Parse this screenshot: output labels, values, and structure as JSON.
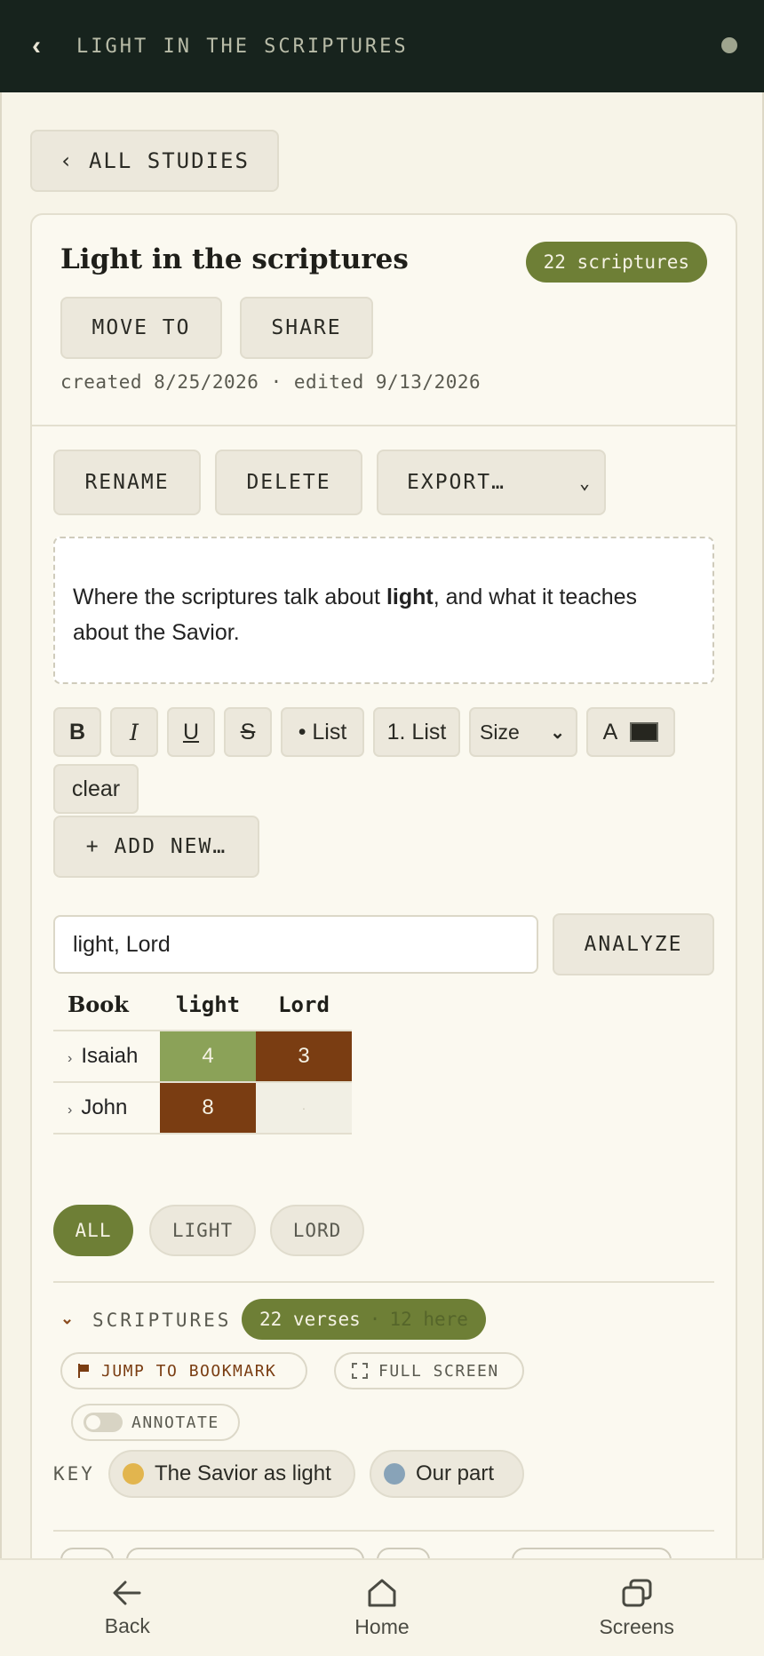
{
  "topbar": {
    "back_glyph": "‹",
    "title": "LIGHT IN THE SCRIPTURES"
  },
  "nav": {
    "all_studies": "‹ ALL STUDIES"
  },
  "study": {
    "title": "Light in the scriptures",
    "badge": "22 scriptures",
    "move_to": "MOVE TO",
    "share": "SHARE",
    "meta": "created 8/25/2026 · edited 9/13/2026"
  },
  "actions": {
    "rename": "RENAME",
    "delete": "DELETE",
    "export": "EXPORT…"
  },
  "description": {
    "before": "Where the scriptures talk about ",
    "bold": "light",
    "after": ", and what it teaches about the Savior."
  },
  "toolbar": {
    "bold": "B",
    "italic": "I",
    "underline": "U",
    "strike": "S",
    "bullet_list": "• List",
    "numbered_list": "1. List",
    "size": "Size",
    "color_label": "A",
    "clear": "clear"
  },
  "add_new": "+ ADD NEW…",
  "analysis": {
    "query": "light, Lord",
    "analyze": "ANALYZE",
    "headers": [
      "Book",
      "light",
      "Lord"
    ],
    "rows": [
      {
        "book": "Isaiah",
        "light": "4",
        "lord": "3"
      },
      {
        "book": "John",
        "light": "8",
        "lord": "·"
      }
    ]
  },
  "filters": {
    "all": "ALL",
    "light": "LIGHT",
    "lord": "LORD"
  },
  "scriptures": {
    "label": "SCRIPTURES",
    "verses": "22 verses",
    "separator": "·",
    "here": "12 here",
    "jump_to_bookmark": "JUMP TO BOOKMARK",
    "full_screen": "FULL SCREEN",
    "annotate": "ANNOTATE"
  },
  "key": {
    "label": "KEY",
    "items": [
      {
        "label": "The Savior as light",
        "color": "#e2b54e"
      },
      {
        "label": "Our part",
        "color": "#88a3b8"
      }
    ]
  },
  "bottom_nav": {
    "back": "Back",
    "home": "Home",
    "screens": "Screens"
  },
  "colors": {
    "accent_green": "#6e7f36",
    "heat_green": "#8ba258",
    "heat_brown": "#7a3d12",
    "topbar": "#17231d"
  }
}
